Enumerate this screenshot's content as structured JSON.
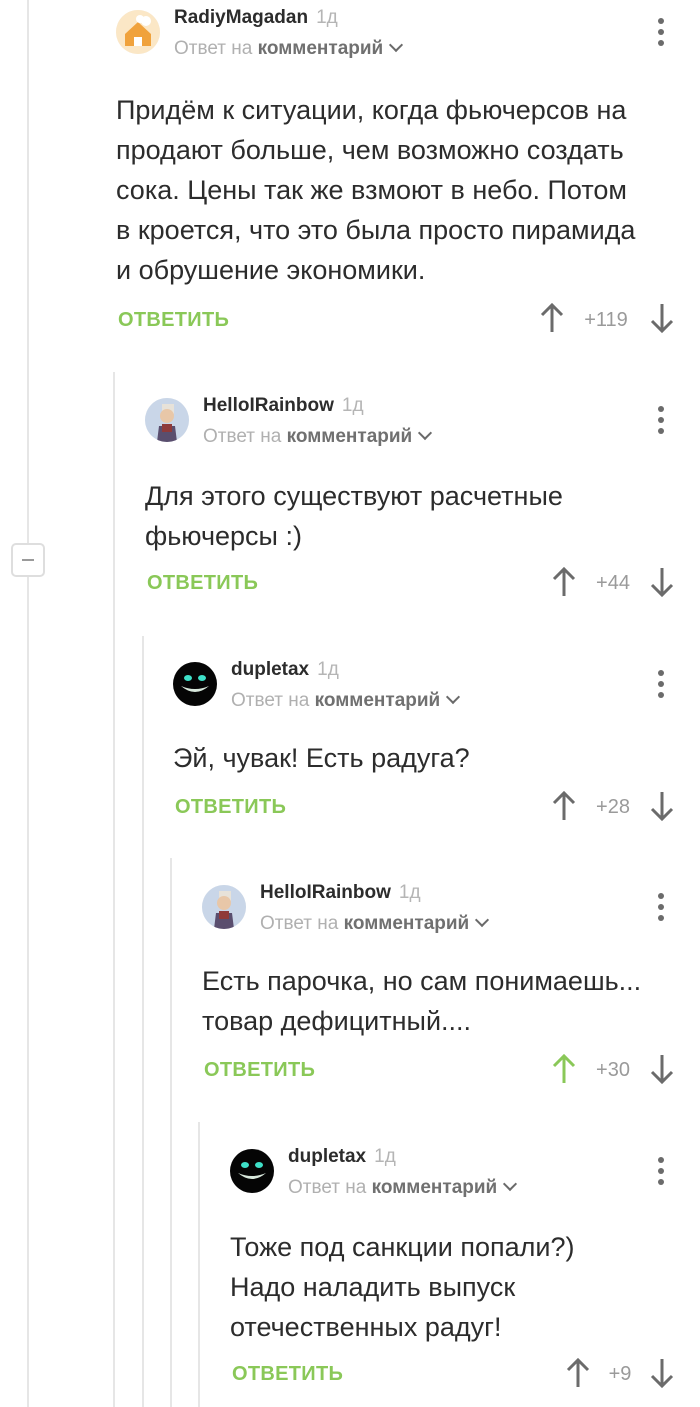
{
  "comments": [
    {
      "author": "RadiyMagadan",
      "time": "1д",
      "reply_prefix": "Ответ на",
      "reply_ref": "комментарий",
      "lines": [
        "Придём к ситуации, когда фьючерсов на",
        "продают больше, чем возможно создать",
        "сока. Цены так же взмоют в небо. Потом",
        "в кроется, что это была просто пирамида",
        "и обрушение экономики."
      ],
      "reply_label": "ОТВЕТИТЬ",
      "score": "+119",
      "avatar_icon": "orange-house-avatar"
    },
    {
      "author": "HelloIRainbow",
      "time": "1д",
      "reply_prefix": "Ответ на",
      "reply_ref": "комментарий",
      "lines": [
        "Для этого существуют расчетные",
        "фьючерсы :)"
      ],
      "reply_label": "ОТВЕТИТЬ",
      "score": "+44",
      "avatar_icon": "figurine-avatar"
    },
    {
      "author": "dupletax",
      "time": "1д",
      "reply_prefix": "Ответ на",
      "reply_ref": "комментарий",
      "lines": [
        "Эй, чувак! Есть радуга?"
      ],
      "reply_label": "ОТВЕТИТЬ",
      "score": "+28",
      "avatar_icon": "cheshire-grin-avatar"
    },
    {
      "author": "HelloIRainbow",
      "time": "1д",
      "reply_prefix": "Ответ на",
      "reply_ref": "комментарий",
      "lines": [
        "Есть парочка, но сам понимаешь...",
        "товар дефицитный...."
      ],
      "reply_label": "ОТВЕТИТЬ",
      "score": "+30",
      "upvoted": true,
      "avatar_icon": "figurine-avatar"
    },
    {
      "author": "dupletax",
      "time": "1д",
      "reply_prefix": "Ответ на",
      "reply_ref": "комментарий",
      "lines": [
        "Тоже под санкции попали?)",
        "Надо наладить выпуск",
        "отечественных радуг!"
      ],
      "reply_label": "ОТВЕТИТЬ",
      "score": "+9",
      "avatar_icon": "cheshire-grin-avatar"
    }
  ],
  "colors": {
    "reply_green": "#8ac858",
    "upvote_active": "#8ac858",
    "arrow_gray": "#6b6b6b",
    "thread_line": "#e6e6e6"
  }
}
